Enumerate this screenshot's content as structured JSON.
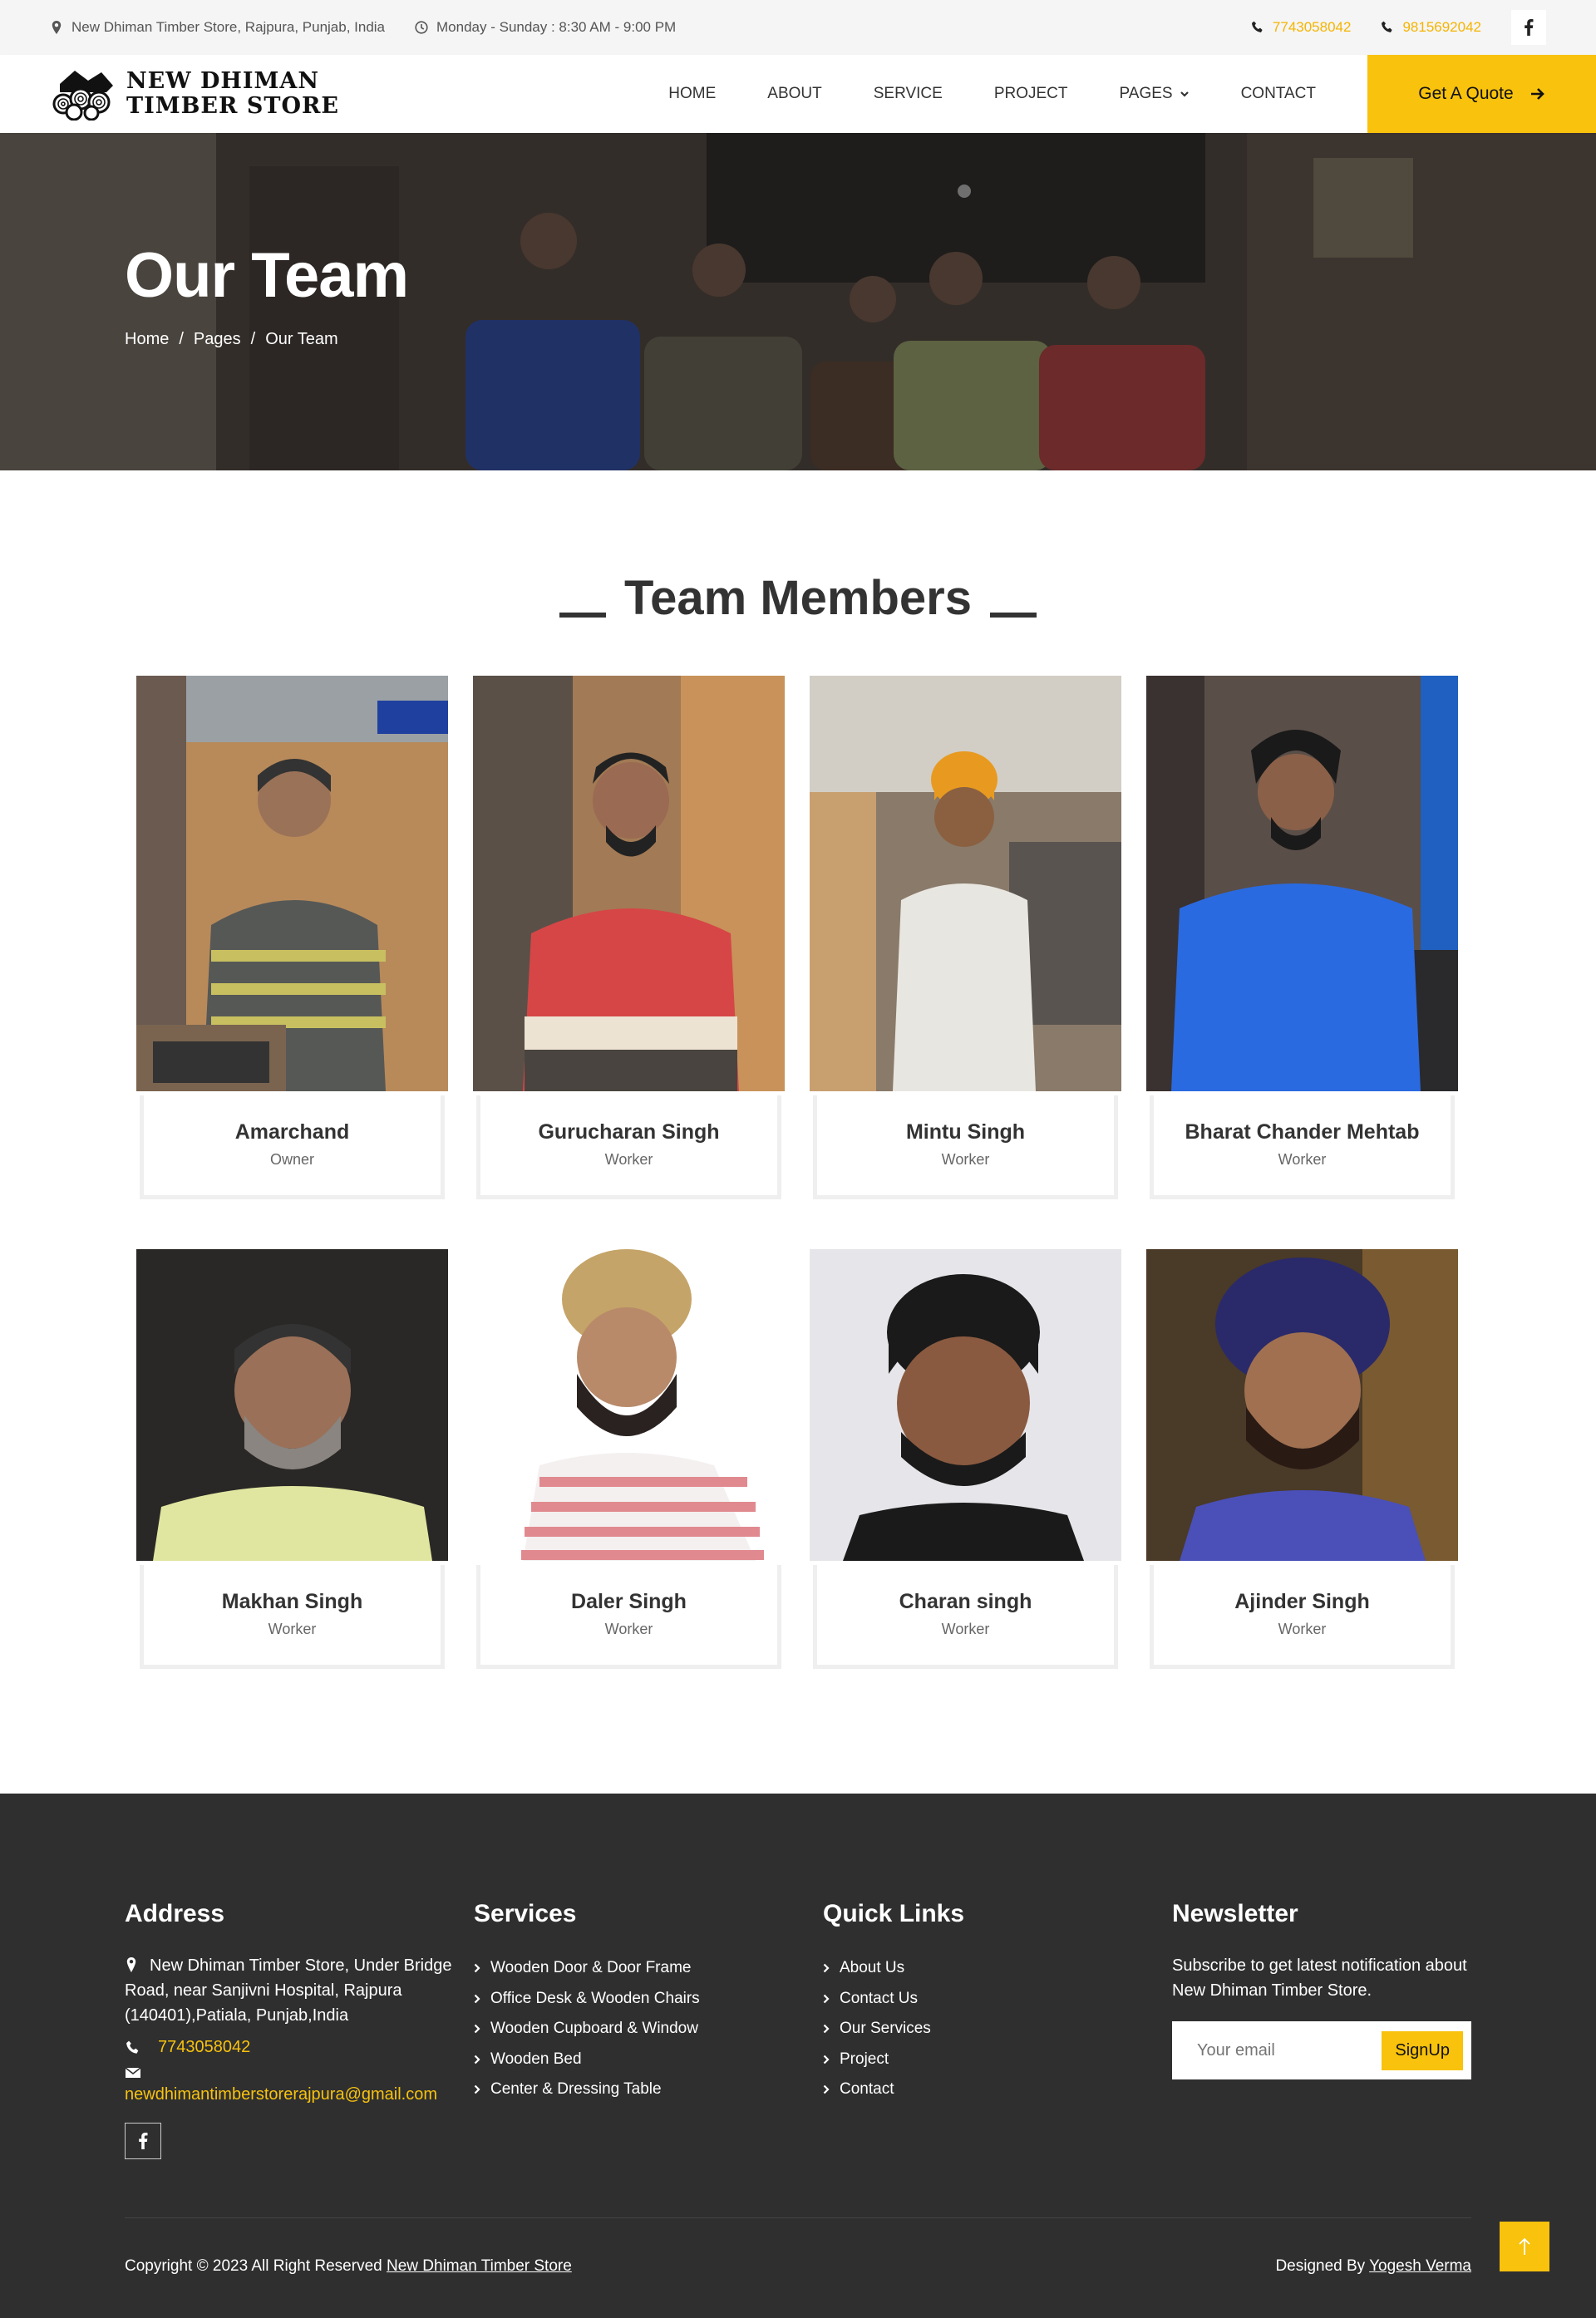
{
  "topbar": {
    "address": "New Dhiman Timber Store, Rajpura, Punjab, India",
    "hours": "Monday - Sunday : 8:30 AM - 9:00 PM",
    "phone1": "7743058042",
    "phone2": "9815692042"
  },
  "brand": {
    "line1": "NEW DHIMAN",
    "line2": "TIMBER STORE"
  },
  "nav": {
    "items": [
      "HOME",
      "ABOUT",
      "SERVICE",
      "PROJECT",
      "PAGES",
      "CONTACT"
    ],
    "quote_label": "Get A Quote"
  },
  "hero": {
    "title": "Our Team",
    "breadcrumb": [
      "Home",
      "Pages",
      "Our Team"
    ],
    "separator": "/"
  },
  "team": {
    "title": "Team Members",
    "members": [
      {
        "name": "Amarchand",
        "role": "Owner"
      },
      {
        "name": "Gurucharan Singh",
        "role": "Worker"
      },
      {
        "name": "Mintu Singh",
        "role": "Worker"
      },
      {
        "name": "Bharat Chander Mehtab",
        "role": "Worker"
      },
      {
        "name": "Makhan Singh",
        "role": "Worker"
      },
      {
        "name": "Daler Singh",
        "role": "Worker"
      },
      {
        "name": "Charan singh",
        "role": "Worker"
      },
      {
        "name": "Ajinder Singh",
        "role": "Worker"
      }
    ]
  },
  "footer": {
    "address": {
      "title": "Address",
      "text": "New Dhiman Timber Store, Under Bridge Road, near Sanjivni Hospital, Rajpura (140401),Patiala, Punjab,India",
      "phone": "7743058042",
      "email": "newdhimantimberstorerajpura@gmail.com"
    },
    "services": {
      "title": "Services",
      "items": [
        "Wooden Door & Door Frame",
        "Office Desk & Wooden Chairs",
        "Wooden Cupboard & Window",
        "Wooden Bed",
        "Center & Dressing Table"
      ]
    },
    "quicklinks": {
      "title": "Quick Links",
      "items": [
        "About Us",
        "Contact Us",
        "Our Services",
        "Project",
        "Contact"
      ]
    },
    "newsletter": {
      "title": "Newsletter",
      "text": "Subscribe to get latest notification about New Dhiman Timber Store.",
      "placeholder": "Your email",
      "button": "SignUp"
    },
    "copyright_prefix": "Copyright © 2023 All Right Reserved",
    "copyright_link": "New Dhiman Timber Store",
    "designed_prefix": "Designed By",
    "designed_link": "Yogesh Verma"
  },
  "colors": {
    "accent": "#f8c20d",
    "footer_bg": "#2f2f30",
    "topbar_bg": "#f5f5f5"
  }
}
